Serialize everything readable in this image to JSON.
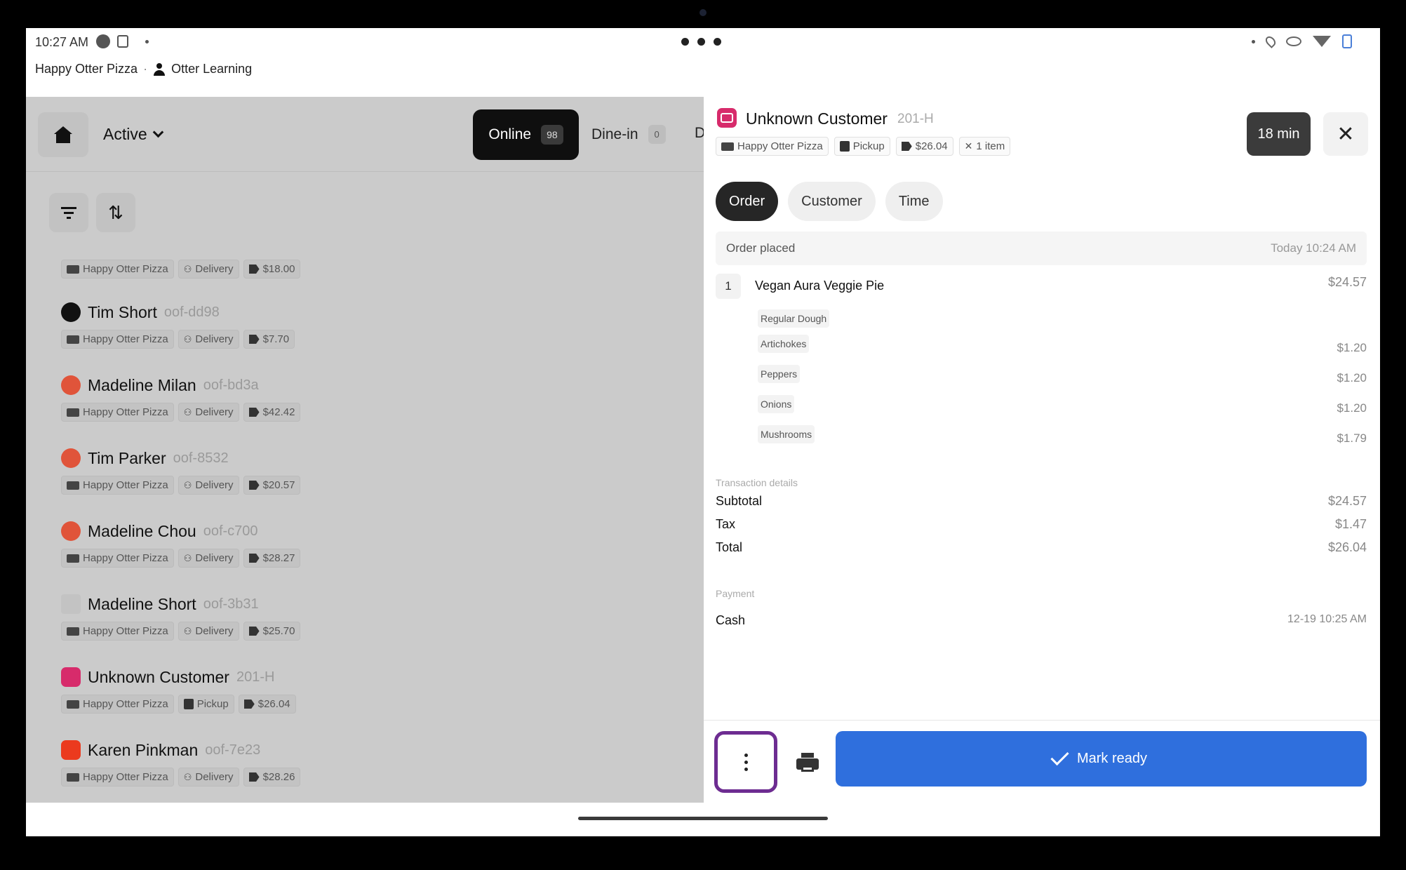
{
  "status_bar": {
    "time": "10:27 AM"
  },
  "store_line": {
    "store": "Happy Otter Pizza",
    "separator": "·",
    "user": "Otter Learning"
  },
  "left": {
    "filter_label": "Active",
    "tabs": [
      {
        "label": "Online",
        "count": "98"
      },
      {
        "label": "Dine-in",
        "count": "0"
      },
      {
        "label": "D"
      }
    ],
    "partial_row": {
      "chips": [
        "Happy Otter Pizza",
        "Delivery",
        "$18.00"
      ]
    },
    "orders": [
      {
        "name": "Tim Short",
        "code": "oof-dd98",
        "brand": "black",
        "store": "Happy Otter Pizza",
        "mode": "Delivery",
        "total": "$7.70"
      },
      {
        "name": "Madeline Milan",
        "code": "oof-bd3a",
        "brand": "red",
        "store": "Happy Otter Pizza",
        "mode": "Delivery",
        "total": "$42.42"
      },
      {
        "name": "Tim Parker",
        "code": "oof-8532",
        "brand": "red",
        "store": "Happy Otter Pizza",
        "mode": "Delivery",
        "total": "$20.57"
      },
      {
        "name": "Madeline Chou",
        "code": "oof-c700",
        "brand": "red",
        "store": "Happy Otter Pizza",
        "mode": "Delivery",
        "total": "$28.27"
      },
      {
        "name": "Madeline Short",
        "code": "oof-3b31",
        "brand": "none",
        "store": "Happy Otter Pizza",
        "mode": "Delivery",
        "total": "$25.70"
      },
      {
        "name": "Unknown Customer",
        "code": "201-H",
        "brand": "pink",
        "store": "Happy Otter Pizza",
        "mode": "Pickup",
        "total": "$26.04"
      },
      {
        "name": "Karen Pinkman",
        "code": "oof-7e23",
        "brand": "doordash",
        "store": "Happy Otter Pizza",
        "mode": "Delivery",
        "total": "$28.26"
      }
    ]
  },
  "detail": {
    "customer": "Unknown Customer",
    "code": "201-H",
    "chips": {
      "store": "Happy Otter Pizza",
      "mode": "Pickup",
      "total": "$26.04",
      "items": "1 item"
    },
    "timer": "18 min",
    "close_glyph": "✕",
    "tabs": [
      "Order",
      "Customer",
      "Time"
    ],
    "placed_label": "Order placed",
    "placed_time": "Today 10:24 AM",
    "item": {
      "qty": "1",
      "name": "Vegan Aura Veggie Pie",
      "price": "$24.57"
    },
    "modifiers": [
      {
        "name": "Regular Dough",
        "price": ""
      },
      {
        "name": "Artichokes",
        "price": "$1.20"
      },
      {
        "name": "Peppers",
        "price": "$1.20"
      },
      {
        "name": "Onions",
        "price": "$1.20"
      },
      {
        "name": "Mushrooms",
        "price": "$1.79"
      }
    ],
    "transaction_label": "Transaction details",
    "subtotal_label": "Subtotal",
    "subtotal": "$24.57",
    "tax_label": "Tax",
    "tax": "$1.47",
    "total_label": "Total",
    "total": "$26.04",
    "payment_label": "Payment",
    "payment_method": "Cash",
    "payment_time": "12-19 10:25 AM",
    "mark_ready": "Mark ready"
  },
  "colors": {
    "primary": "#2f6fdd",
    "highlight": "#6d2c91",
    "brand_pink": "#d72b6b",
    "brand_red": "#e0543a"
  }
}
